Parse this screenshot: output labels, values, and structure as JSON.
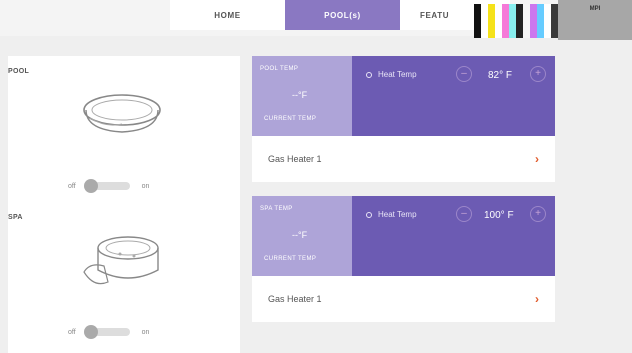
{
  "nav": {
    "tabs": [
      "HOME",
      "POOL(s)",
      "FEATU"
    ]
  },
  "status": {
    "label": "MPI"
  },
  "left": {
    "pool": {
      "label": "POOL",
      "off": "off",
      "on": "on"
    },
    "spa": {
      "label": "SPA",
      "off": "off",
      "on": "on"
    }
  },
  "pool_card": {
    "temp_label": "POOL TEMP",
    "current": "--°F",
    "sub_label": "CURRENT TEMP",
    "heat_label": "Heat Temp",
    "setpoint": "82° F",
    "heater": "Gas Heater 1"
  },
  "spa_card": {
    "temp_label": "SPA TEMP",
    "current": "--°F",
    "sub_label": "CURRENT TEMP",
    "heat_label": "Heat Temp",
    "setpoint": "100° F",
    "heater": "Gas Heater 1"
  },
  "colors": {
    "accent": "#6c5bb3",
    "accent_light": "#aea4d8",
    "chevron": "#e15a2a"
  }
}
